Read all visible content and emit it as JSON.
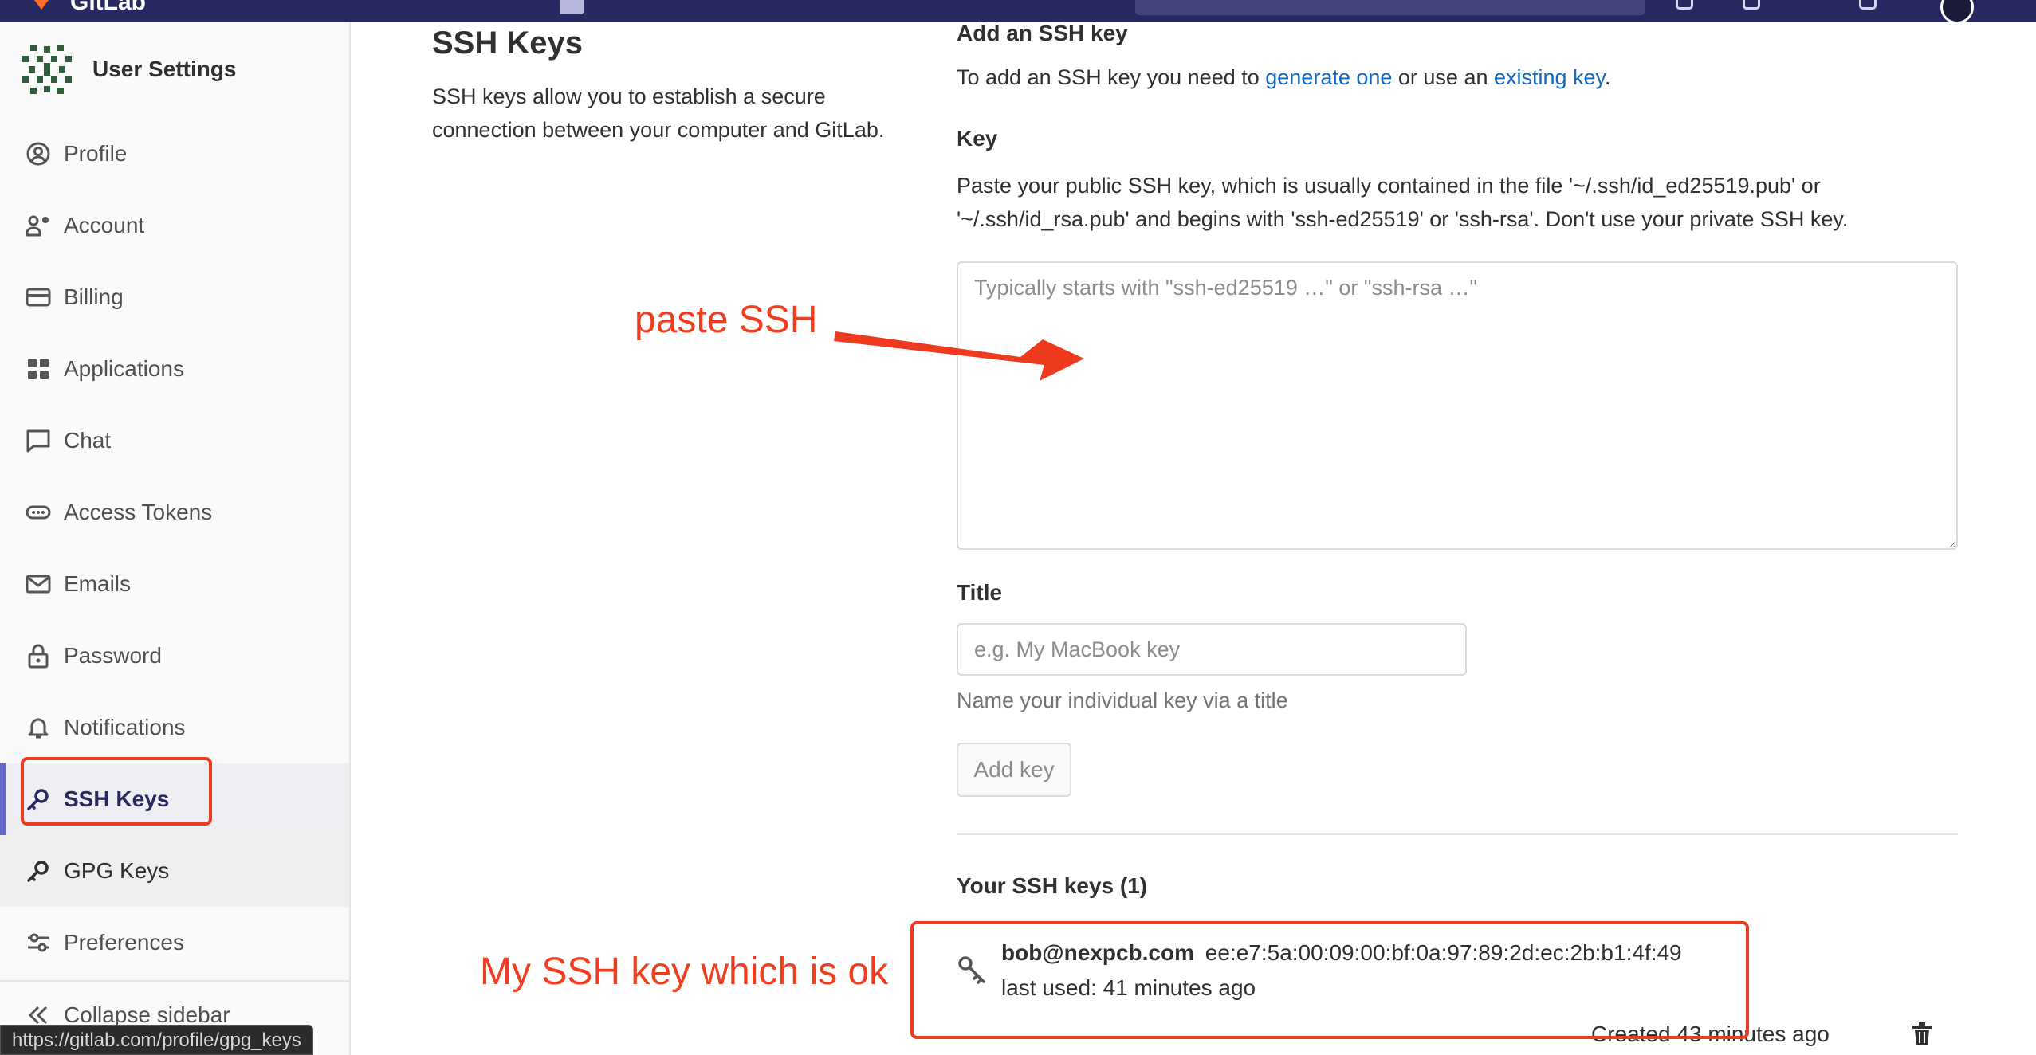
{
  "topbar": {
    "brand": "GitLab"
  },
  "sidebar": {
    "context_title": "User Settings",
    "items": [
      {
        "label": "Profile",
        "icon": "profile-icon"
      },
      {
        "label": "Account",
        "icon": "account-icon"
      },
      {
        "label": "Billing",
        "icon": "billing-icon"
      },
      {
        "label": "Applications",
        "icon": "applications-icon"
      },
      {
        "label": "Chat",
        "icon": "chat-icon"
      },
      {
        "label": "Access Tokens",
        "icon": "access-tokens-icon"
      },
      {
        "label": "Emails",
        "icon": "email-icon"
      },
      {
        "label": "Password",
        "icon": "lock-icon"
      },
      {
        "label": "Notifications",
        "icon": "bell-icon"
      },
      {
        "label": "SSH Keys",
        "icon": "key-icon"
      },
      {
        "label": "GPG Keys",
        "icon": "key-icon"
      },
      {
        "label": "Preferences",
        "icon": "preferences-icon"
      }
    ],
    "active_item": "SSH Keys",
    "collapse_label": "Collapse sidebar"
  },
  "statusbar": {
    "url": "https://gitlab.com/profile/gpg_keys"
  },
  "page": {
    "title": "SSH Keys",
    "description": "SSH keys allow you to establish a secure connection between your computer and GitLab."
  },
  "form": {
    "section_title": "Add an SSH key",
    "intro_prefix": "To add an SSH key you need to ",
    "intro_link1": "generate one",
    "intro_middle": " or use an ",
    "intro_link2": "existing key",
    "intro_suffix": ".",
    "key_label": "Key",
    "key_help": "Paste your public SSH key, which is usually contained in the file '~/.ssh/id_ed25519.pub' or '~/.ssh/id_rsa.pub' and begins with 'ssh-ed25519' or 'ssh-rsa'. Don't use your private SSH key.",
    "key_placeholder": "Typically starts with \"ssh-ed25519 …\" or \"ssh-rsa …\"",
    "key_value": "",
    "title_label": "Title",
    "title_placeholder": "e.g. My MacBook key",
    "title_value": "",
    "title_help": "Name your individual key via a title",
    "add_button": "Add key"
  },
  "keys_list": {
    "heading": "Your SSH keys (1)",
    "keys": [
      {
        "email": "bob@nexpcb.com",
        "fingerprint": "ee:e7:5a:00:09:00:bf:0a:97:89:2d:ec:2b:b1:4f:49",
        "last_used": "last used: 41 minutes ago",
        "created": "Created 43 minutes ago"
      }
    ]
  },
  "annotations": {
    "paste_label": "paste SSH",
    "key_ok_label": "My SSH key which is ok",
    "color": "#ee3a1e"
  },
  "colors": {
    "topbar": "#292961",
    "link": "#1068bf",
    "active_nav": "#292961",
    "active_indicator": "#6666c4"
  }
}
